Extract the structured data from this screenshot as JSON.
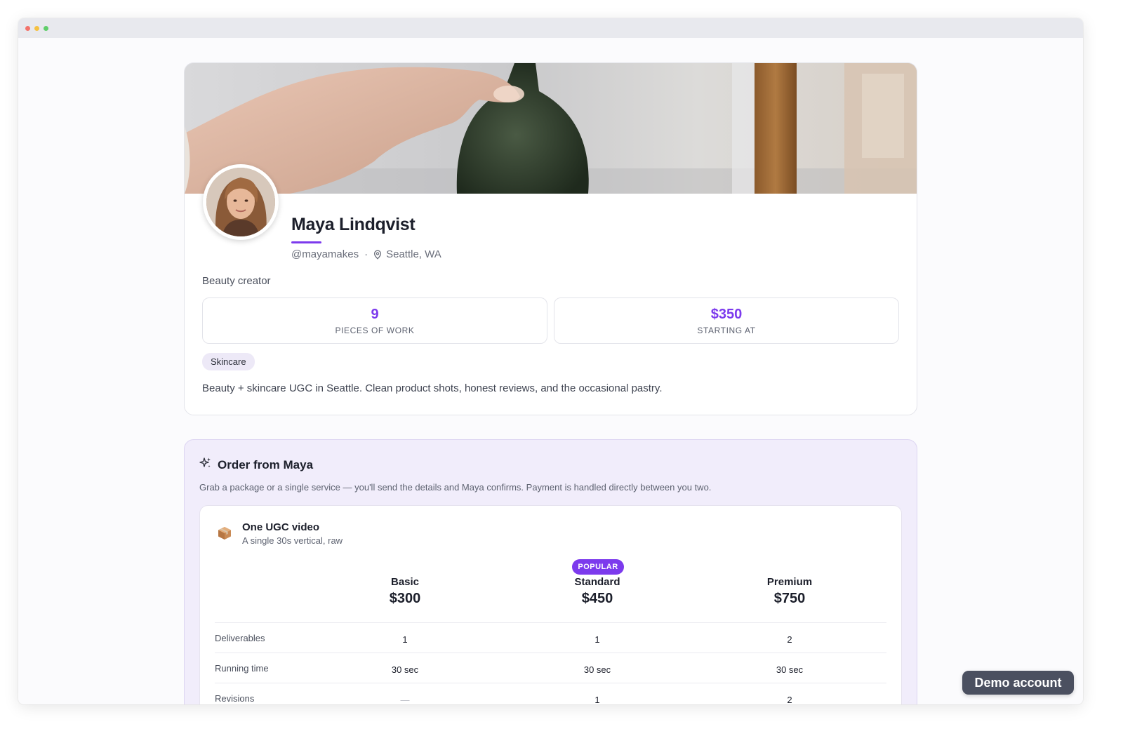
{
  "profile": {
    "name": "Maya Lindqvist",
    "handle": "@mayamakes",
    "separator": "·",
    "location": "Seattle, WA",
    "category": "Beauty creator",
    "stats": [
      {
        "value": "9",
        "label": "PIECES OF WORK"
      },
      {
        "value": "$350",
        "label": "STARTING AT"
      }
    ],
    "tag": "Skincare",
    "bio": "Beauty + skincare UGC in Seattle. Clean product shots, honest reviews, and the occasional pastry."
  },
  "order": {
    "title": "Order from Maya",
    "subtitle": "Grab a package or a single service — you'll send the details and Maya confirms. Payment is handled directly between you two.",
    "package": {
      "title": "One UGC video",
      "description": "A single 30s vertical, raw",
      "popular_label": "POPULAR",
      "tiers": [
        {
          "name": "Basic",
          "price": "$300"
        },
        {
          "name": "Standard",
          "price": "$450"
        },
        {
          "name": "Premium",
          "price": "$750"
        }
      ],
      "rows": [
        {
          "label": "Deliverables",
          "values": [
            "1",
            "1",
            "2"
          ]
        },
        {
          "label": "Running time",
          "values": [
            "30 sec",
            "30 sec",
            "30 sec"
          ]
        },
        {
          "label": "Revisions",
          "values": [
            "—",
            "1",
            "2"
          ]
        }
      ]
    }
  },
  "demo_badge": "Demo account",
  "colors": {
    "accent": "#7c3aed",
    "order_bg": "#f1edfb",
    "tag_bg": "#ede9f7",
    "badge_bg": "#4b5060"
  },
  "icons": {
    "location": "map-pin-icon",
    "order": "sparkle-icon",
    "package": "package-box-icon"
  }
}
